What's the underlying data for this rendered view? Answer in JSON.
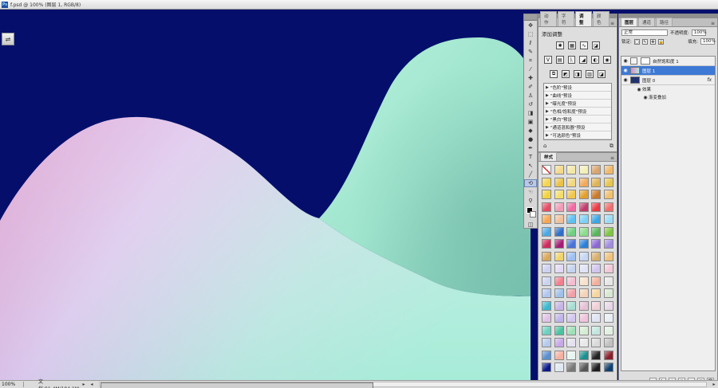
{
  "document": {
    "title": "f.psd @ 100% (图层 1, RGB/8)",
    "app_icon_text": "Ps",
    "zoom": "100%",
    "doc_info": "文档:91.4M/184.1M",
    "colors": {
      "background": "#050f6b",
      "left_hill_top": "#e7ccef",
      "left_hill_pink": "#d58ec4",
      "left_hill_mint": "#a7ecd8",
      "right_hill": "#9de6cc"
    }
  },
  "options_button": {
    "icon": "sliders-icon",
    "glyph": "⇌"
  },
  "tools": {
    "items": [
      {
        "name": "move-tool-icon",
        "glyph": "✥"
      },
      {
        "name": "marquee-tool-icon",
        "glyph": "⬚"
      },
      {
        "name": "lasso-tool-icon",
        "glyph": "ℓ"
      },
      {
        "name": "quick-select-tool-icon",
        "glyph": "✎"
      },
      {
        "name": "crop-tool-icon",
        "glyph": "⌗"
      },
      {
        "name": "eyedropper-tool-icon",
        "glyph": "⁄"
      },
      {
        "name": "heal-brush-tool-icon",
        "glyph": "✚"
      },
      {
        "name": "brush-tool-icon",
        "glyph": "✐"
      },
      {
        "name": "clone-stamp-tool-icon",
        "glyph": "♙"
      },
      {
        "name": "history-brush-tool-icon",
        "glyph": "↺"
      },
      {
        "name": "eraser-tool-icon",
        "glyph": "◨"
      },
      {
        "name": "gradient-tool-icon",
        "glyph": "▣"
      },
      {
        "name": "blur-tool-icon",
        "glyph": "◆"
      },
      {
        "name": "dodge-tool-icon",
        "glyph": "●"
      },
      {
        "name": "pen-tool-icon",
        "glyph": "✒"
      },
      {
        "name": "type-tool-icon",
        "glyph": "T"
      },
      {
        "name": "path-select-tool-icon",
        "glyph": "↖"
      },
      {
        "name": "shape-tool-icon",
        "glyph": "╱"
      },
      {
        "name": "3d-rotate-tool-icon",
        "glyph": "⟲"
      },
      {
        "name": "hand-tool-icon",
        "glyph": "☜"
      },
      {
        "name": "zoom-tool-icon",
        "glyph": "⚲"
      }
    ]
  },
  "adjustments": {
    "tabs": [
      "动作",
      "字符",
      "调整",
      "颜色"
    ],
    "active_tab": "调整",
    "header": "添加调整",
    "row1_icons": [
      "✺",
      "▦",
      "∿",
      "◪"
    ],
    "row2_icons": [
      "V",
      "▤",
      "ᚣ",
      "◢",
      "◐",
      "◉"
    ],
    "row3_icons": [
      "⧉",
      "◩",
      "◨",
      "▥",
      "◪"
    ],
    "presets": [
      "\"色阶\"预设",
      "\"曲线\"预设",
      "\"曝光度\"预设",
      "\"色相/饱和度\"预设",
      "\"黑白\"预设",
      "\"通道混和器\"预设",
      "\"可选颜色\"预设"
    ],
    "footer_left": "⌂",
    "footer_right": "⧉"
  },
  "styles": {
    "tab": "样式",
    "swatches": [
      "#ffffff",
      "#f5d98a",
      "#f3e7a6",
      "#f2efb8",
      "#d7a56e",
      "#f0b96a",
      "#f4d44b",
      "#e9c24a",
      "#f2d680",
      "#f2a95a",
      "#dfb456",
      "#e7c54e",
      "#f2d23c",
      "#f3dd6a",
      "#f1c64c",
      "#e3a02b",
      "#c97a2a",
      "#f0c06c",
      "#e74a63",
      "#f09bb7",
      "#ef6aa2",
      "#c13b6b",
      "#e93a45",
      "#f26d6d",
      "#f6a653",
      "#f0c09a",
      "#5ec0f0",
      "#7bd1f7",
      "#3aa6e4",
      "#9adbf6",
      "#4aa9e6",
      "#2f6fc6",
      "#6fd084",
      "#8bdc8d",
      "#58b65a",
      "#7ec742",
      "#d12a5c",
      "#a31c74",
      "#4a73d6",
      "#2a7fd8",
      "#8a68d4",
      "#a18de3",
      "#d9a85b",
      "#f0d26a",
      "#9ec0f2",
      "#c6d6f4",
      "#d8b06e",
      "#f0c27a",
      "#cdd1f2",
      "#e3d8f5",
      "#c5d3f0",
      "#e0e3f7",
      "#d1c4ef",
      "#f3c8d8",
      "#c9d3ef",
      "#f27f8e",
      "#f4bcd0",
      "#f6e1cc",
      "#f2b09c",
      "#e6e6e6",
      "#b0c6f0",
      "#a0c0e8",
      "#f0a0a8",
      "#f4d3b8",
      "#f6d5a0",
      "#d7e7d0",
      "#3ab9d0",
      "#c7b4e6",
      "#a8dcd4",
      "#e5c1d6",
      "#f0cfd7",
      "#e8d6e8",
      "#e0c0e6",
      "#bfb3ea",
      "#d3c6f0",
      "#f0c2dc",
      "#dfe3f2",
      "#e8edf5",
      "#6bd0c0",
      "#4cc2a0",
      "#9fe0b8",
      "#d4ecd3",
      "#c2e5dd",
      "#e2f0e2",
      "#b5c9ec",
      "#c6a8e6",
      "#e3e0f0",
      "#e8e8e8",
      "#d9d9d9",
      "#c0c0c0",
      "#5a8fd0",
      "#f4b0a0",
      "#e8f4f0",
      "#1b8f8f",
      "#222222",
      "#8a1f2a",
      "#0a1a8a",
      "#dfe8f0",
      "#777777",
      "#555555",
      "#1d1d1d",
      "#0f3f6f"
    ]
  },
  "layers": {
    "tabs": [
      "图层",
      "通道",
      "路径"
    ],
    "active_tab": "图层",
    "blend_mode": "正常",
    "opacity_label": "不透明度:",
    "opacity_value": "100%",
    "lock_label": "锁定:",
    "fill_label": "填充:",
    "fill_value": "100%",
    "items": [
      {
        "name": "自然饱和度 1",
        "type": "adjustment",
        "visible": true,
        "selected": false,
        "thumb_color": "#ffffff"
      },
      {
        "name": "图层 1",
        "type": "pixel",
        "visible": true,
        "selected": true,
        "thumb_color": "#e1b9e8"
      },
      {
        "name": "图层 0",
        "type": "pixel",
        "visible": true,
        "selected": false,
        "thumb_color": "#233270",
        "fx": "fx"
      }
    ],
    "effects_label": "效果",
    "effect_item": "渐变叠加",
    "footer_icons": [
      "∞",
      "fx",
      "◐",
      "▢",
      "▭",
      "▤",
      "🗑"
    ]
  }
}
